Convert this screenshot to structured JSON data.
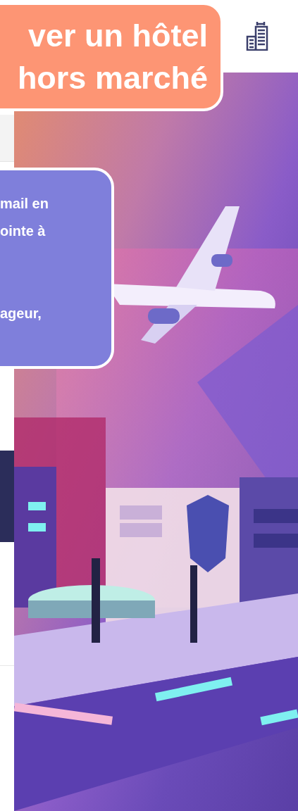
{
  "headline": {
    "lines": [
      "ver un hôtel",
      "hors marché"
    ]
  },
  "info_callout": {
    "text": "mail en\nointe à\n\n\nageur,"
  }
}
